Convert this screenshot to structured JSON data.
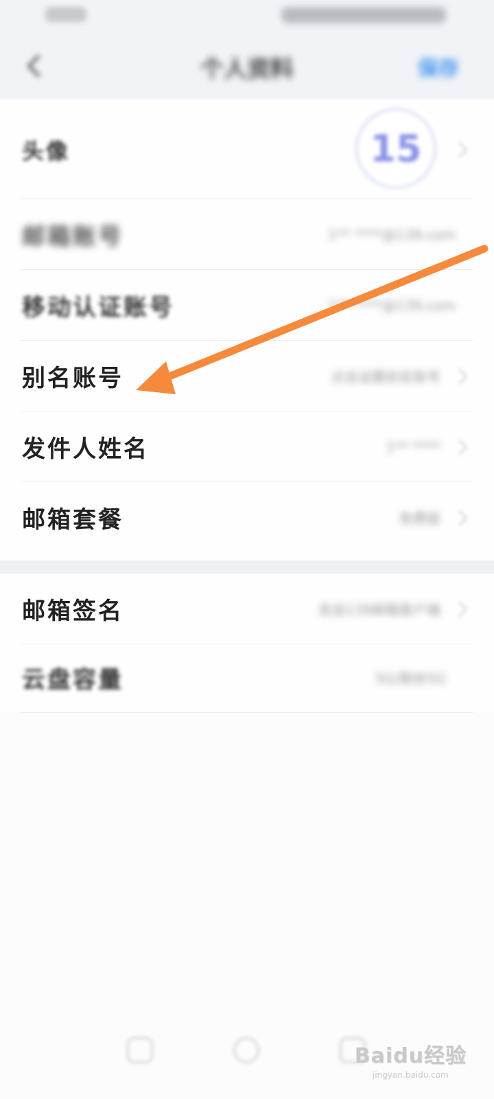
{
  "status_bar": {
    "time": "",
    "icons": ""
  },
  "nav": {
    "title": "个人资料",
    "save_label": "保存"
  },
  "settings": {
    "avatar_row": {
      "label": "头像",
      "avatar_text": "15"
    },
    "rows": [
      {
        "label": "邮箱账号",
        "value": "1** ****@139.com"
      },
      {
        "label": "移动认证账号",
        "value": "1** ****@139.com"
      },
      {
        "label": "别名账号",
        "value": "点击设置别名账号"
      },
      {
        "label": "发件人姓名",
        "value": "1** ****"
      },
      {
        "label": "邮箱套餐",
        "value": "免费版"
      }
    ],
    "rows_group2": [
      {
        "label": "邮箱签名",
        "value": "发自139邮箱客户端"
      },
      {
        "label": "云盘容量",
        "value": "5G/剩余5G"
      }
    ]
  },
  "annotation": {
    "arrow_color": "#f58a3c"
  },
  "watermark": {
    "logo": "Baidu经验",
    "url": "jingyan.baidu.com"
  },
  "colors": {
    "accent": "#3d8ff0",
    "arrow": "#f58a3c"
  }
}
